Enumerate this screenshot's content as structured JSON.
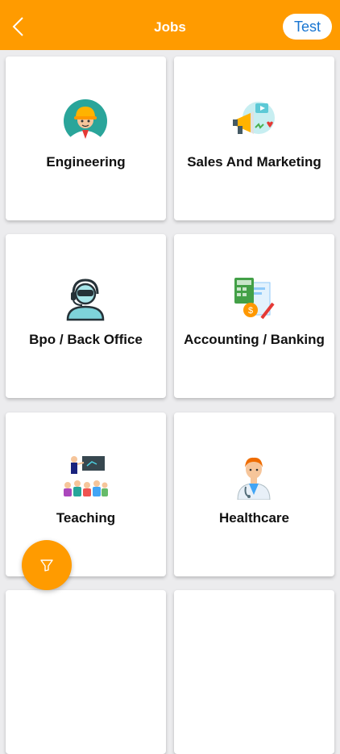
{
  "header": {
    "title": "Jobs",
    "test_label": "Test",
    "color": "#ff9b00"
  },
  "categories": [
    {
      "label": "Engineering",
      "icon": "engineer-icon"
    },
    {
      "label": "Sales And Marketing",
      "icon": "megaphone-icon"
    },
    {
      "label": "Bpo / Back Office",
      "icon": "headset-agent-icon"
    },
    {
      "label": "Accounting / Banking",
      "icon": "calculator-invoice-icon"
    },
    {
      "label": "Teaching",
      "icon": "teacher-class-icon"
    },
    {
      "label": "Healthcare",
      "icon": "doctor-icon"
    }
  ],
  "fab": {
    "icon": "filter-icon"
  }
}
